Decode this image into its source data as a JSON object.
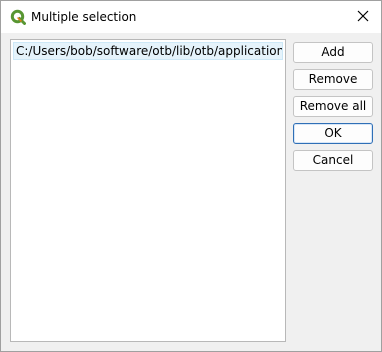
{
  "window": {
    "title": "Multiple selection",
    "app_icon": "qgis-logo-icon",
    "close_icon": "close-icon"
  },
  "list": {
    "items": [
      {
        "label": "C:/Users/bob/software/otb/lib/otb/applications",
        "selected": true
      }
    ]
  },
  "buttons": {
    "add": "Add",
    "remove": "Remove",
    "remove_all": "Remove all",
    "ok": "OK",
    "cancel": "Cancel"
  },
  "colors": {
    "selection_bg": "#e5f3fb",
    "default_button_border": "#2f6fb6",
    "qgis_green": "#589632",
    "qgis_yellow": "#ee7913"
  }
}
